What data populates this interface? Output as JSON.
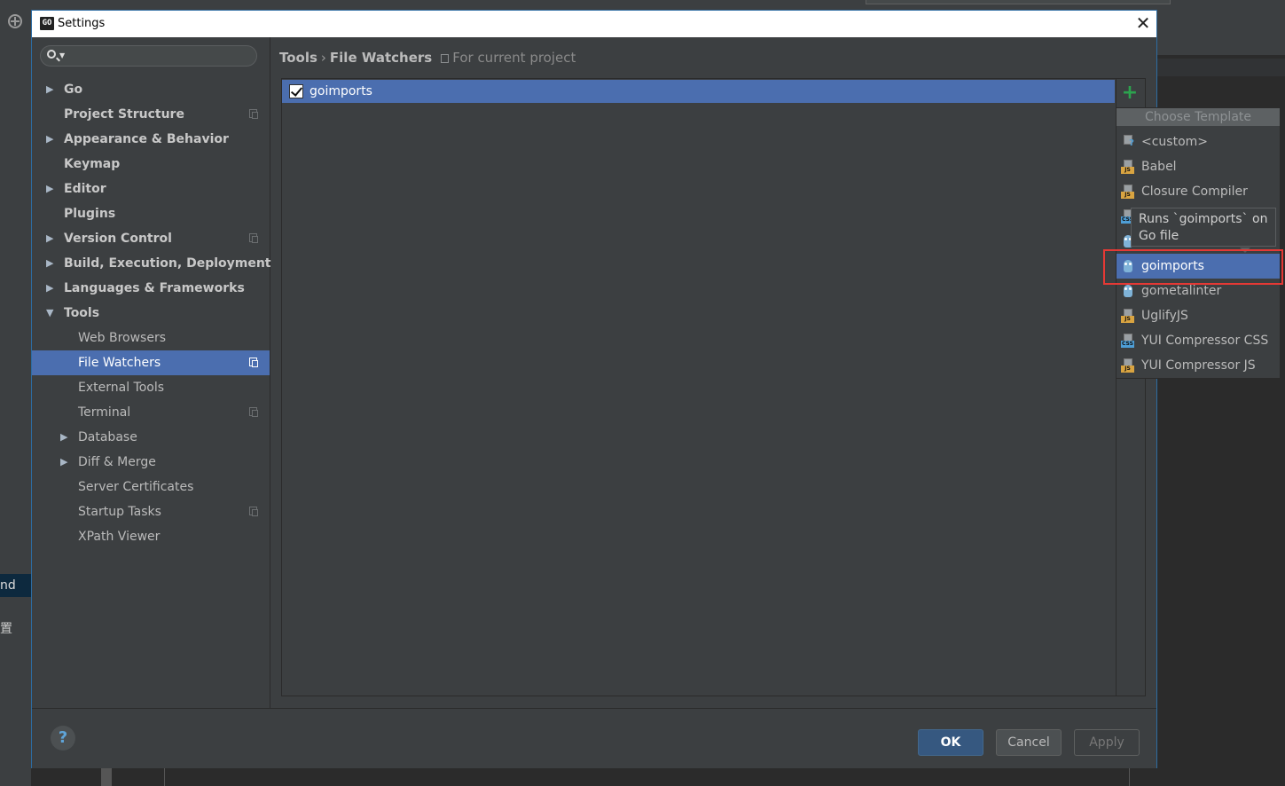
{
  "background": {
    "left_selected_text": "nd",
    "left_text": "置"
  },
  "dialog": {
    "title": "Settings",
    "app_icon_text": "GO",
    "close_label": "✕"
  },
  "sidebar": {
    "search_placeholder": "",
    "items": [
      {
        "label": "Go",
        "level": 0,
        "arrow": "▶",
        "bold": true
      },
      {
        "label": "Project Structure",
        "level": 0,
        "bold": true,
        "project_icon": true
      },
      {
        "label": "Appearance & Behavior",
        "level": 0,
        "arrow": "▶",
        "bold": true
      },
      {
        "label": "Keymap",
        "level": 0,
        "bold": true
      },
      {
        "label": "Editor",
        "level": 0,
        "arrow": "▶",
        "bold": true
      },
      {
        "label": "Plugins",
        "level": 0,
        "bold": true
      },
      {
        "label": "Version Control",
        "level": 0,
        "arrow": "▶",
        "bold": true,
        "project_icon": true
      },
      {
        "label": "Build, Execution, Deployment",
        "level": 0,
        "arrow": "▶",
        "bold": true
      },
      {
        "label": "Languages & Frameworks",
        "level": 0,
        "arrow": "▶",
        "bold": true
      },
      {
        "label": "Tools",
        "level": 0,
        "arrow": "▼",
        "bold": true
      },
      {
        "label": "Web Browsers",
        "level": 1
      },
      {
        "label": "File Watchers",
        "level": 1,
        "selected": true,
        "project_icon": true
      },
      {
        "label": "External Tools",
        "level": 1
      },
      {
        "label": "Terminal",
        "level": 1,
        "project_icon": true
      },
      {
        "label": "Database",
        "level": 1,
        "arrow": "▶"
      },
      {
        "label": "Diff & Merge",
        "level": 1,
        "arrow": "▶"
      },
      {
        "label": "Server Certificates",
        "level": 1
      },
      {
        "label": "Startup Tasks",
        "level": 1,
        "project_icon": true
      },
      {
        "label": "XPath Viewer",
        "level": 1
      }
    ]
  },
  "breadcrumb": {
    "part1": "Tools",
    "separator": "›",
    "part2": "File Watchers",
    "scope": "For current project"
  },
  "watchers": {
    "rows": [
      {
        "label": "goimports",
        "checked": true
      }
    ],
    "add_label": "+"
  },
  "popup": {
    "title": "Choose Template",
    "items": [
      {
        "label": "<custom>",
        "icon": "custom-file-icon",
        "tag": "?"
      },
      {
        "label": "Babel",
        "icon": "js-file-icon",
        "tag": "JS"
      },
      {
        "label": "Closure Compiler",
        "icon": "js-file-icon",
        "tag": "JS"
      },
      {
        "label": "",
        "icon": "css-file-icon",
        "tag": "CSS"
      },
      {
        "label": "",
        "icon": "gopher-icon"
      },
      {
        "label": "goimports",
        "icon": "gopher-icon",
        "selected": true
      },
      {
        "label": "gometalinter",
        "icon": "gopher-icon"
      },
      {
        "label": "UglifyJS",
        "icon": "js-file-icon",
        "tag": "JS"
      },
      {
        "label": "YUI Compressor CSS",
        "icon": "css-file-icon",
        "tag": "CSS"
      },
      {
        "label": "YUI Compressor JS",
        "icon": "js-file-icon",
        "tag": "JS"
      }
    ],
    "tooltip": "Runs `goimports` on Go file"
  },
  "footer": {
    "help_label": "?",
    "ok_label": "OK",
    "cancel_label": "Cancel",
    "apply_label": "Apply"
  },
  "colors": {
    "selection": "#4b6eaf",
    "highlight_box": "#e53935",
    "add_green": "#2ca34e",
    "ok_button": "#365880"
  }
}
